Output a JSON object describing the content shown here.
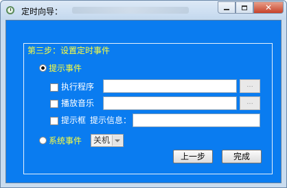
{
  "window": {
    "title": "定时向导：",
    "close_label": "✕"
  },
  "step_title": "第三步：设置定时事件",
  "prompt_event": {
    "label": "提示事件",
    "selected": true,
    "run_program": {
      "label": "执行程序",
      "value": "",
      "browse_label": "..."
    },
    "play_music": {
      "label": "播放音乐",
      "value": "",
      "browse_label": "..."
    },
    "prompt_box": {
      "label": "提示框",
      "info_label": "提示信息：",
      "value": ""
    }
  },
  "system_event": {
    "label": "系统事件",
    "selected": false,
    "action_selected": "关机"
  },
  "buttons": {
    "prev_label": "上一步",
    "finish_label": "完成"
  }
}
